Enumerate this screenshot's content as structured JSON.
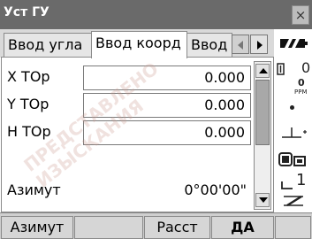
{
  "window": {
    "title": "Уст ГУ",
    "close_label": "×"
  },
  "tabs": [
    {
      "label": "Ввод угла"
    },
    {
      "label": "Ввод коорд"
    },
    {
      "label": "Ввод"
    }
  ],
  "fields": {
    "x": {
      "label": "X TOp",
      "value": "0.000"
    },
    "y": {
      "label": "Y TOp",
      "value": "0.000"
    },
    "h": {
      "label": "H TOp",
      "value": "0.000"
    }
  },
  "azimuth": {
    "label": "Азимут",
    "value": "0°00'00\""
  },
  "status": {
    "ppm_value": "0",
    "ppm_label": "PPM",
    "prism_const": "0",
    "page_number": "1"
  },
  "softkeys": [
    {
      "label": "Азимут"
    },
    {
      "label": ""
    },
    {
      "label": "Расст"
    },
    {
      "label": "ДА"
    },
    {
      "label": ""
    }
  ],
  "watermark": {
    "line1": "ПРЕДСТАВЛЕНО",
    "line2": "ИЗЫСКАНИЯ"
  }
}
